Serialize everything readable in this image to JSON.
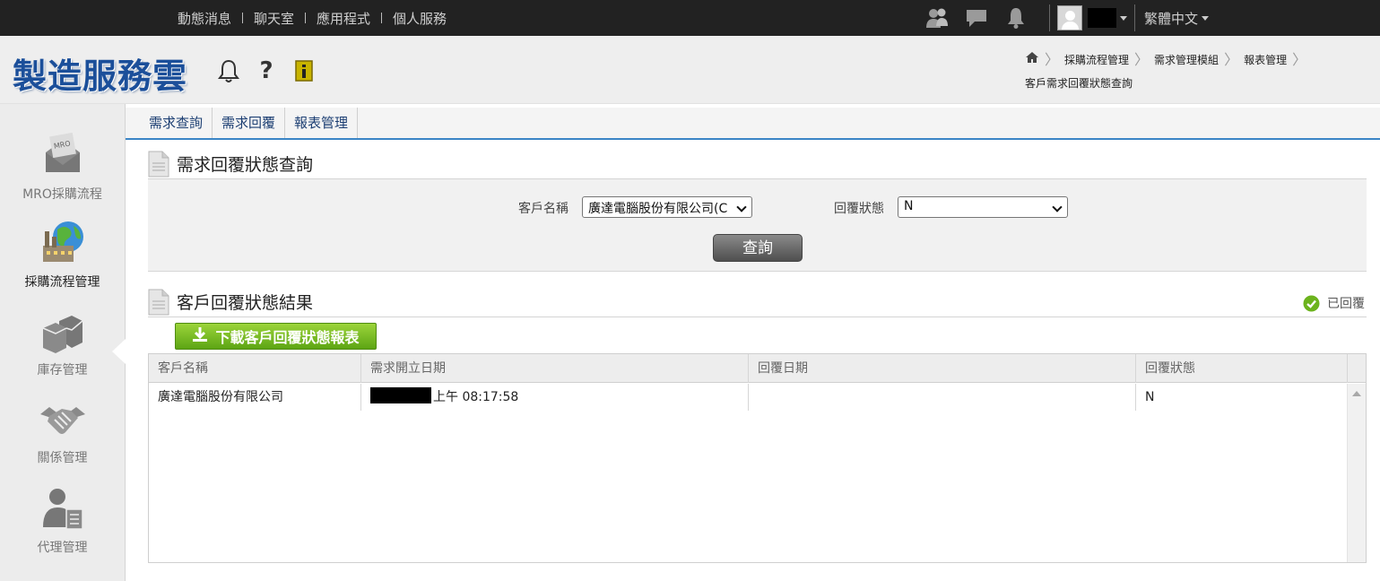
{
  "top_nav": {
    "items": [
      "動態消息",
      "聊天室",
      "應用程式",
      "個人服務"
    ],
    "icons": [
      "contacts-icon",
      "chat-icon",
      "notification-bell-icon"
    ],
    "language": "繁體中文"
  },
  "header": {
    "logo": "製造服務雲",
    "breadcrumb": [
      "採購流程管理",
      "需求管理模組",
      "報表管理"
    ],
    "current_page": "客戶需求回覆狀態查詢"
  },
  "sidebar": {
    "items": [
      {
        "label": "MRO採購流程",
        "icon": "mro-envelope-icon",
        "active": false
      },
      {
        "label": "採購流程管理",
        "icon": "factory-globe-icon",
        "active": true
      },
      {
        "label": "庫存管理",
        "icon": "boxes-icon",
        "active": false
      },
      {
        "label": "關係管理",
        "icon": "handshake-icon",
        "active": false
      },
      {
        "label": "代理管理",
        "icon": "agent-document-icon",
        "active": false
      }
    ]
  },
  "tabs": [
    "需求查詢",
    "需求回覆",
    "報表管理"
  ],
  "query_section": {
    "title": "需求回覆狀態查詢",
    "customer_label": "客戶名稱",
    "customer_value": "廣達電腦股份有限公司(C",
    "status_label": "回覆狀態",
    "status_value": "N",
    "query_button": "查詢"
  },
  "result_section": {
    "title": "客戶回覆狀態結果",
    "legend_replied": "已回覆",
    "download_button": "下載客戶回覆狀態報表",
    "columns": [
      "客戶名稱",
      "需求開立日期",
      "回覆日期",
      "回覆狀態"
    ],
    "rows": [
      {
        "customer": "廣達電腦股份有限公司",
        "open_time": "上午 08:17:58",
        "reply_date": "",
        "status": "N"
      }
    ]
  },
  "colors": {
    "topbar": "#222222",
    "logo": "#1b4f9a",
    "tab_underline": "#3a85c6",
    "download_button": "#6cb31d",
    "legend_check": "#6cb31d"
  }
}
